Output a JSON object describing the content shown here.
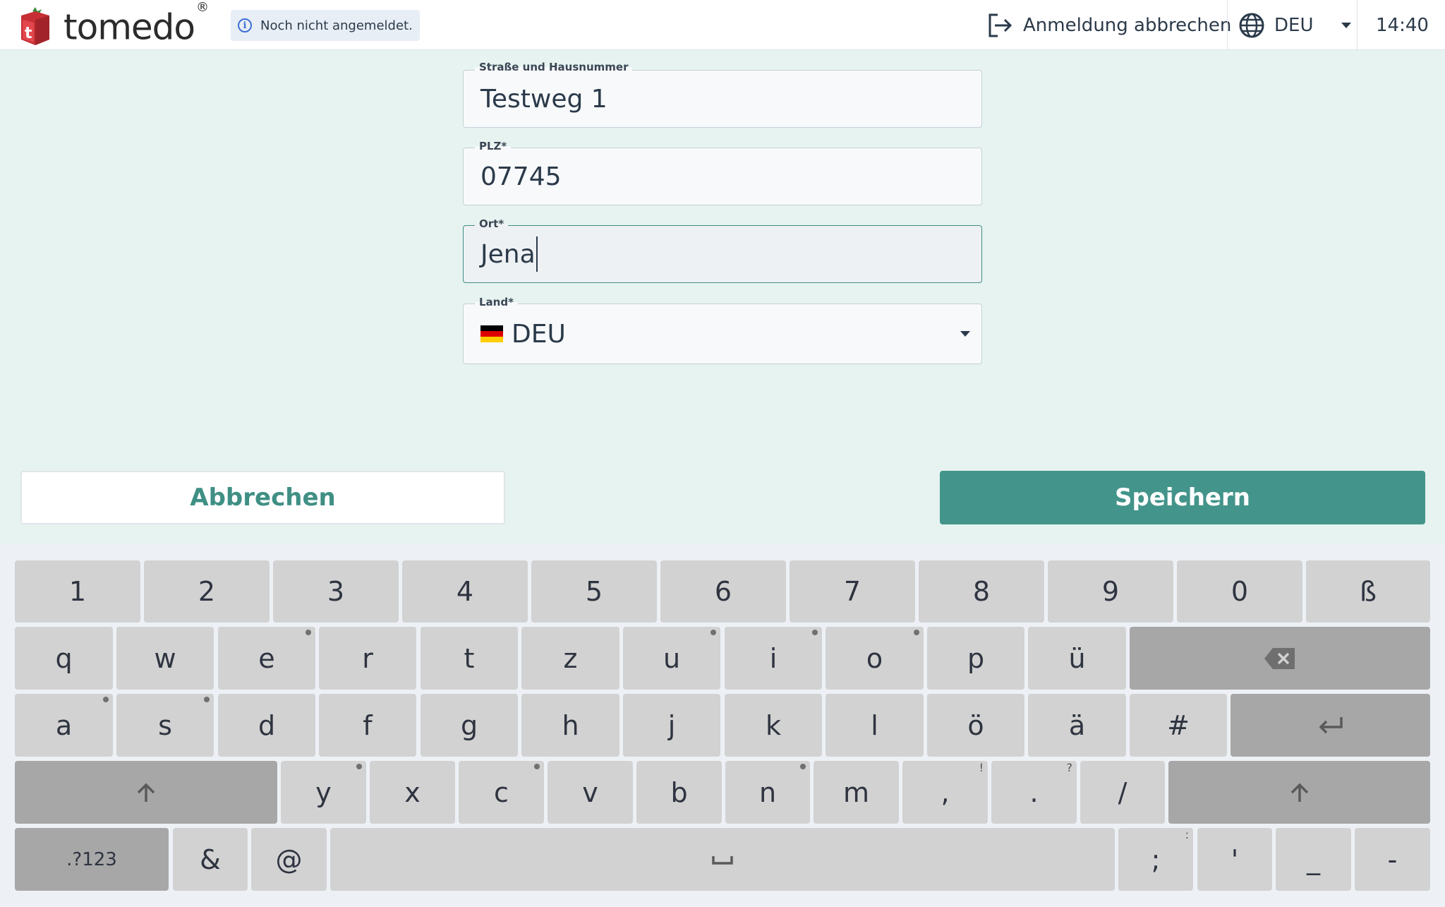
{
  "header": {
    "brand": "tomedo",
    "brand_mark": "®",
    "login_status": "Noch nicht angemeldet.",
    "cancel_login": "Anmeldung abbrechen",
    "language": "DEU",
    "time": "14:40"
  },
  "form": {
    "street": {
      "label": "Straße und Hausnummer",
      "value": "Testweg 1"
    },
    "zip": {
      "label": "PLZ*",
      "value": "07745"
    },
    "city": {
      "label": "Ort*",
      "value": "Jena"
    },
    "country": {
      "label": "Land*",
      "value": "DEU"
    }
  },
  "actions": {
    "cancel": "Abbrechen",
    "save": "Speichern"
  },
  "keyboard": {
    "row1": [
      "1",
      "2",
      "3",
      "4",
      "5",
      "6",
      "7",
      "8",
      "9",
      "0",
      "ß"
    ],
    "row2": [
      "q",
      "w",
      "e",
      "r",
      "t",
      "z",
      "u",
      "i",
      "o",
      "p",
      "ü"
    ],
    "row3": [
      "a",
      "s",
      "d",
      "f",
      "g",
      "h",
      "j",
      "k",
      "l",
      "ö",
      "ä",
      "#"
    ],
    "row4": [
      "y",
      "x",
      "c",
      "v",
      "b",
      "n",
      "m",
      ",",
      ".",
      "/"
    ],
    "row4_hints": {
      "comma": "!",
      "period": "?"
    },
    "row5": {
      "mode": ".?123",
      "amp": "&",
      "at": "@",
      "semicolon": ";",
      "semicolon_hint": ":",
      "apostrophe": "'",
      "underscore": "_",
      "dash": "-"
    }
  },
  "colors": {
    "accent": "#43948a",
    "background": "#e6f3f0",
    "key": "#d2d2d2",
    "key_dark": "#a7a7a7"
  }
}
